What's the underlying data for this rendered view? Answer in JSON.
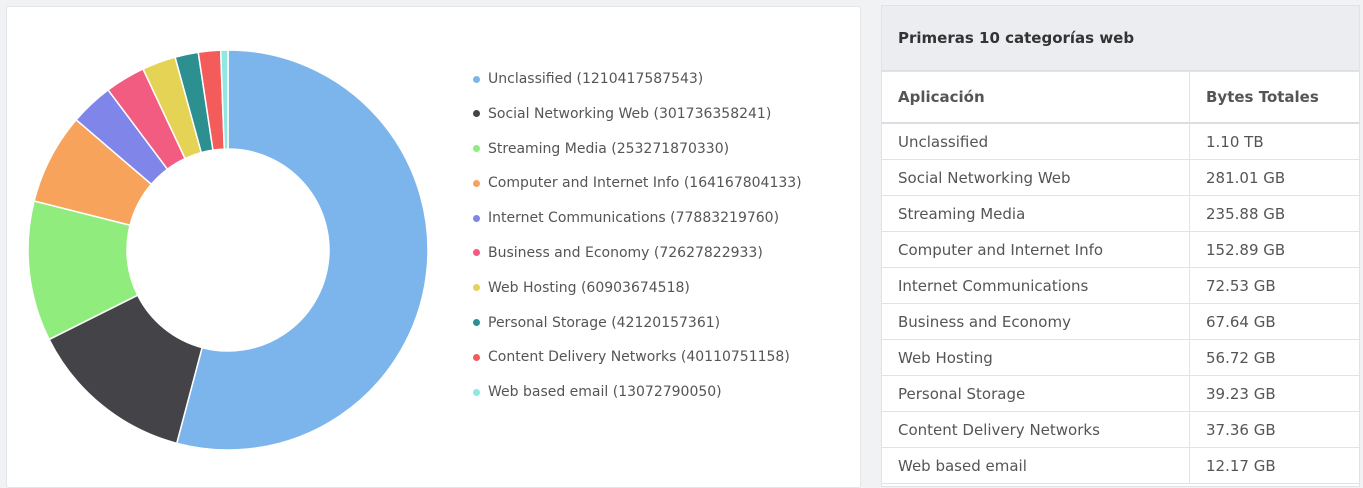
{
  "chart_data": {
    "type": "pie",
    "donut": true,
    "categories": [
      "Unclassified",
      "Social Networking Web",
      "Streaming Media",
      "Computer and Internet Info",
      "Internet Communications",
      "Business and Economy",
      "Web Hosting",
      "Personal Storage",
      "Content Delivery Networks",
      "Web based email"
    ],
    "values": [
      1210417587543,
      301736358241,
      253271870330,
      164167804133,
      77883219760,
      72627822933,
      60903674518,
      42120157361,
      40110751158,
      13072790050
    ],
    "legend_labels": [
      "Unclassified (1210417587543)",
      "Social Networking Web (301736358241)",
      "Streaming Media (253271870330)",
      "Computer and Internet Info (164167804133)",
      "Internet Communications (77883219760)",
      "Business and Economy (72627822933)",
      "Web Hosting (60903674518)",
      "Personal Storage (42120157361)",
      "Content Delivery Networks (40110751158)",
      "Web based email (13072790050)"
    ],
    "colors": [
      "#7cb5ec",
      "#434348",
      "#90ed7d",
      "#f7a35c",
      "#8085e9",
      "#f15c80",
      "#e4d354",
      "#2b908f",
      "#f45b5b",
      "#91e8e1"
    ],
    "legend_position": "right"
  },
  "table": {
    "title": "Primeras 10 categorías web",
    "headers": [
      "Aplicación",
      "Bytes Totales"
    ],
    "rows": [
      [
        "Unclassified",
        "1.10 TB"
      ],
      [
        "Social Networking Web",
        "281.01 GB"
      ],
      [
        "Streaming Media",
        "235.88 GB"
      ],
      [
        "Computer and Internet Info",
        "152.89 GB"
      ],
      [
        "Internet Communications",
        "72.53 GB"
      ],
      [
        "Business and Economy",
        "67.64 GB"
      ],
      [
        "Web Hosting",
        "56.72 GB"
      ],
      [
        "Personal Storage",
        "39.23 GB"
      ],
      [
        "Content Delivery Networks",
        "37.36 GB"
      ],
      [
        "Web based email",
        "12.17 GB"
      ]
    ]
  }
}
